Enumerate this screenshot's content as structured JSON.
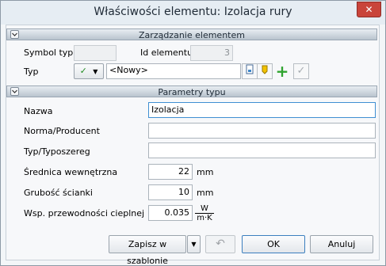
{
  "window": {
    "title": "Właściwości elementu: Izolacja rury",
    "close_glyph": "✕"
  },
  "management": {
    "header": "Zarządzanie elementem",
    "symbol_label": "Symbol typu",
    "symbol_value": "",
    "id_label": "Id elementu",
    "id_value": "3",
    "type_label": "Typ",
    "type_value": "<Nowy>"
  },
  "params": {
    "header": "Parametry typu",
    "name_label": "Nazwa",
    "name_value": "Izolacja",
    "norm_label": "Norma/Producent",
    "norm_value": "",
    "series_label": "Typ/Typoszereg",
    "series_value": "",
    "inner_diameter_label": "Średnica wewnętrzna",
    "inner_diameter_value": "22",
    "inner_diameter_unit": "mm",
    "wall_thickness_label": "Grubość ścianki",
    "wall_thickness_value": "10",
    "wall_thickness_unit": "mm",
    "conductivity_label": "Wsp. przewodności cieplnej",
    "conductivity_value": "0.035",
    "conductivity_unit_num": "W",
    "conductivity_unit_den": "m·K"
  },
  "footer": {
    "save_template_label": "Zapisz w szablonie",
    "ok_label": "OK",
    "cancel_label": "Anuluj"
  },
  "icons": {
    "check": "✓",
    "dropdown": "▼",
    "add": "+",
    "collapse": "⌄",
    "undo": "↶"
  },
  "colors": {
    "accent": "#3f8fd2",
    "add_green": "#2fa32f",
    "close_red": "#c9443a"
  }
}
